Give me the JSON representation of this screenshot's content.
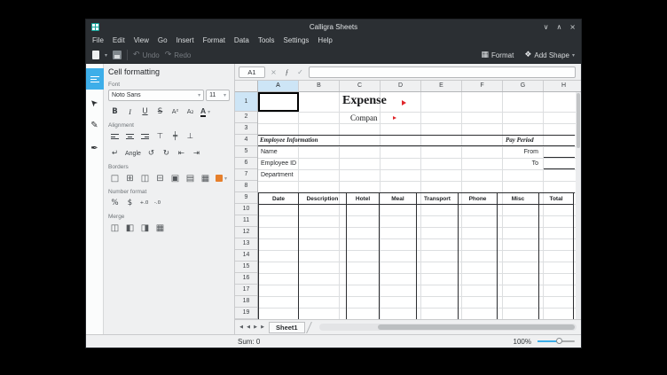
{
  "window": {
    "title": "Calligra Sheets",
    "controls": {
      "minimize": "∨",
      "maximize": "∧",
      "close": "×"
    }
  },
  "icons": {
    "chevron": "▾",
    "undo": "↶",
    "redo": "↷",
    "format_grid": "▦",
    "add_shape": "❖"
  },
  "menu": {
    "items": [
      "File",
      "Edit",
      "View",
      "Go",
      "Insert",
      "Format",
      "Data",
      "Tools",
      "Settings",
      "Help"
    ]
  },
  "toolbar": {
    "undo": "Undo",
    "redo": "Redo",
    "format": "Format",
    "add_shape": "Add Shape"
  },
  "toolbox": {
    "tabs": [
      {
        "name": "cell-format-tool",
        "selected": true
      },
      {
        "name": "shape-selection-tool",
        "icon": "➤"
      },
      {
        "name": "pencil-tool",
        "icon": "✎"
      },
      {
        "name": "calligraphy-tool",
        "icon": "✒"
      }
    ]
  },
  "panel": {
    "title": "Cell formatting",
    "font_label": "Font",
    "font_name": "Noto Sans",
    "font_size": "11",
    "alignment_label": "Alignment",
    "angle": "Angle",
    "borders_label": "Borders",
    "number_label": "Number format",
    "merge_label": "Merge",
    "format_buttons": {
      "bold": "B",
      "italic": "I",
      "underline": "U",
      "strike": "S",
      "superscript": "A²",
      "subscript": "A₂",
      "font_color": "A"
    },
    "valign": {
      "top": "⊤",
      "middle": "╪",
      "bottom": "⊥"
    },
    "rotation": {
      "wrap": "↵",
      "ccw": "↺",
      "cw": "↻",
      "indent_less": "⇤",
      "indent_more": "⇥"
    },
    "border_buttons": [
      "□",
      "⊞",
      "◫",
      "⊟",
      "▣",
      "▤",
      "▦"
    ],
    "number_buttons": [
      "%",
      "$",
      "+.0",
      "-.0"
    ],
    "merge_buttons": [
      "◫",
      "◧",
      "◨",
      "▦"
    ]
  },
  "formula_bar": {
    "cell_ref": "A1",
    "cancel": "×",
    "function": "ƒ",
    "apply": "✓"
  },
  "sheet": {
    "col_headers": [
      "A",
      "B",
      "C",
      "D",
      "E",
      "F",
      "G",
      "H"
    ],
    "row_headers": [
      "1",
      "2",
      "3",
      "4",
      "5",
      "6",
      "7",
      "8",
      "9",
      "10",
      "11",
      "12",
      "13",
      "14",
      "15",
      "16",
      "17",
      "18",
      "19"
    ],
    "content": {
      "title": "Expense",
      "company": "Compan",
      "employee_information": "Employee Information",
      "pay_period": "Pay Period",
      "name": "Name",
      "employee_id": "Employee ID",
      "department": "Department",
      "from": "From",
      "to": "To"
    },
    "table_headers": [
      "Date",
      "Description",
      "Hotel",
      "Meal",
      "Transport",
      "Phone",
      "Misc",
      "Total"
    ]
  },
  "tabbar": {
    "sheet_name": "Sheet1",
    "nav": [
      "◀",
      "◀",
      "▶",
      "▶"
    ]
  },
  "status": {
    "sum": "Sum: 0",
    "zoom": "100%"
  },
  "colors": {
    "accent": "#3daee9",
    "overflow_marker": "#e0262b",
    "border_swatch": "#e67f2b"
  }
}
